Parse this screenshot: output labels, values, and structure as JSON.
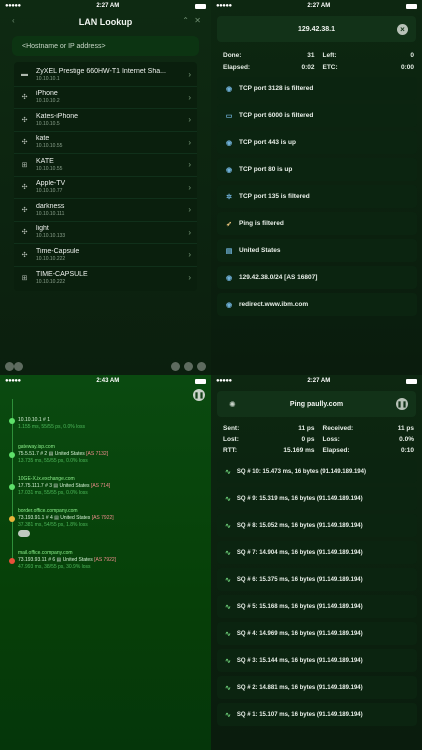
{
  "status": {
    "q1_time": "2:27 AM",
    "q2_time": "2:27 AM",
    "q3_time": "2:43 AM",
    "q4_time": "2:27 AM"
  },
  "lookup": {
    "title": "LAN Lookup",
    "search_placeholder": "<Hostname or IP address>",
    "hosts": [
      {
        "name": "ZyXEL Prestige 660HW-T1 Internet Sha...",
        "ip": "10.10.10.1",
        "icon": "router-icon"
      },
      {
        "name": "iPhone",
        "ip": "10.10.10.2",
        "icon": "apple-icon"
      },
      {
        "name": "Kates-iPhone",
        "ip": "10.10.10.5",
        "icon": "apple-icon"
      },
      {
        "name": "kate",
        "ip": "10.10.10.55",
        "icon": "apple-icon"
      },
      {
        "name": "KATE",
        "ip": "10.10.10.55",
        "icon": "windows-icon"
      },
      {
        "name": "Apple-TV",
        "ip": "10.10.10.77",
        "icon": "apple-icon"
      },
      {
        "name": "darkness",
        "ip": "10.10.10.111",
        "icon": "apple-icon"
      },
      {
        "name": "light",
        "ip": "10.10.10.133",
        "icon": "apple-icon"
      },
      {
        "name": "Time-Capsule",
        "ip": "10.10.10.222",
        "icon": "apple-icon"
      },
      {
        "name": "TIME-CAPSULE",
        "ip": "10.10.10.222",
        "icon": "windows-icon"
      }
    ]
  },
  "scan": {
    "target": "129.42.38.1",
    "done_label": "Done:",
    "done_value": "31",
    "left_label": "Left:",
    "left_value": "0",
    "elapsed_label": "Elapsed:",
    "elapsed_value": "0:02",
    "etc_label": "ETC:",
    "etc_value": "0:00",
    "results": [
      {
        "text": "TCP port 3128 is filtered",
        "icon": "globe-icon"
      },
      {
        "text": "TCP port 6000 is filtered",
        "icon": "monitor-icon"
      },
      {
        "text": "TCP port 443 is up",
        "icon": "globe-icon"
      },
      {
        "text": "TCP port 80 is up",
        "icon": "globe-icon"
      },
      {
        "text": "TCP port 135 is filtered",
        "icon": "gear-icon"
      },
      {
        "text": "Ping is filtered",
        "icon": "rocket-icon"
      },
      {
        "text": "United States",
        "icon": "flag-icon"
      },
      {
        "text": "129.42.38.0/24 [AS 16807]",
        "icon": "globe-icon"
      },
      {
        "text": "redirect.www.ibm.com",
        "icon": "globe-icon"
      }
    ]
  },
  "trace": {
    "hops": [
      {
        "host": "",
        "ip": "10.10.10.1",
        "num": "# 1",
        "country": "",
        "asn": "",
        "time": "1.155 ms, 55/55 ps, 0.0% loss"
      },
      {
        "host": "gateway.isp.com",
        "ip": "75.5.51.7",
        "num": "# 2",
        "country": "United States",
        "asn": "[AS 7132]",
        "time": "13.735 ms, 55/55 ps, 0.0% loss"
      },
      {
        "host": "10GE-X.ix.exchange.com",
        "ip": "17.75.111.7",
        "num": "# 3",
        "country": "United States",
        "asn": "[AS 714]",
        "time": "17.031 ms, 55/55 ps, 0.0% loss"
      },
      {
        "host": "border.office.company.com",
        "ip": "73.193.91.1",
        "num": "# 4",
        "country": "United States",
        "asn": "[AS 7922]",
        "time": "37.381 ms, 54/55 ps, 1.8% loss"
      },
      {
        "host": "mail.office.company.com",
        "ip": "73.193.93.11",
        "num": "# 6",
        "country": "United States",
        "asn": "[AS 7922]",
        "time": "47.993 ms, 38/55 ps, 30.9% loss"
      }
    ]
  },
  "ping": {
    "title": "Ping paully.com",
    "sent_label": "Sent:",
    "sent_value": "11 ps",
    "received_label": "Received:",
    "received_value": "11 ps",
    "lost_label": "Lost:",
    "lost_value": "0 ps",
    "loss_label": "Loss:",
    "loss_value": "0.0%",
    "rtt_label": "RTT:",
    "rtt_value": "15.169 ms",
    "elapsed_label": "Elapsed:",
    "elapsed_value": "0:10",
    "replies": [
      "SQ # 10: 15.473 ms, 16 bytes (91.149.189.194)",
      "SQ # 9: 15.319 ms, 16 bytes (91.149.189.194)",
      "SQ # 8: 15.052 ms, 16 bytes (91.149.189.194)",
      "SQ # 7: 14.904 ms, 16 bytes (91.149.189.194)",
      "SQ # 6: 15.375 ms, 16 bytes (91.149.189.194)",
      "SQ # 5: 15.168 ms, 16 bytes (91.149.189.194)",
      "SQ # 4: 14.969 ms, 16 bytes (91.149.189.194)",
      "SQ # 3: 15.144 ms, 16 bytes (91.149.189.194)",
      "SQ # 2: 14.881 ms, 16 bytes (91.149.189.194)",
      "SQ # 1: 15.107 ms, 16 bytes (91.149.189.194)"
    ]
  }
}
